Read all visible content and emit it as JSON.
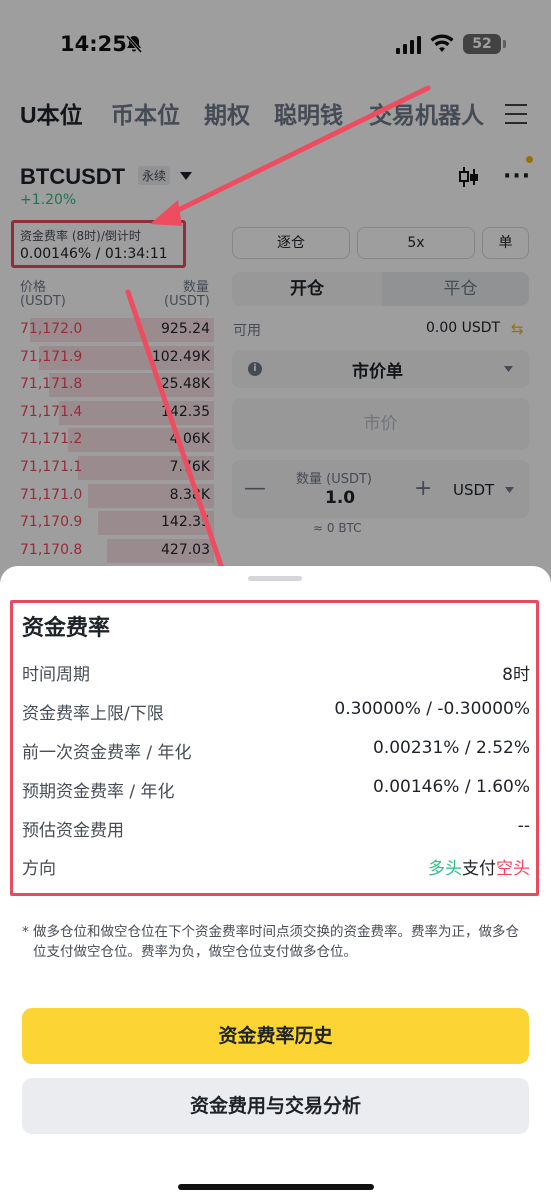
{
  "status_bar": {
    "time": "14:25",
    "battery": "52"
  },
  "top_nav": {
    "items": [
      "U本位",
      "币本位",
      "期权",
      "聪明钱",
      "交易机器人"
    ]
  },
  "ticker": {
    "symbol": "BTCUSDT",
    "tag": "永续",
    "change": "+1.20%"
  },
  "funding": {
    "label": "资金费率 (8时)/倒计时",
    "value": "0.00146% / 01:34:11"
  },
  "orderbook": {
    "price_header": "价格",
    "price_unit": "(USDT)",
    "qty_header": "数量",
    "qty_unit": "(USDT)",
    "rows": [
      {
        "price": "71,172.0",
        "qty": "925.24",
        "depth": 0.95
      },
      {
        "price": "71,171.9",
        "qty": "102.49K",
        "depth": 0.9
      },
      {
        "price": "71,171.8",
        "qty": "25.48K",
        "depth": 0.85
      },
      {
        "price": "71,171.4",
        "qty": "142.35",
        "depth": 0.8
      },
      {
        "price": "71,171.2",
        "qty": "4.06K",
        "depth": 0.75
      },
      {
        "price": "71,171.1",
        "qty": "7.76K",
        "depth": 0.7
      },
      {
        "price": "71,171.0",
        "qty": "8.38K",
        "depth": 0.65
      },
      {
        "price": "71,170.9",
        "qty": "142.35",
        "depth": 0.6
      },
      {
        "price": "71,170.8",
        "qty": "427.03",
        "depth": 0.55
      }
    ]
  },
  "order_panel": {
    "margin_mode": "逐仓",
    "leverage": "5x",
    "position_mode": "单",
    "open_tab": "开仓",
    "close_tab": "平仓",
    "available_label": "可用",
    "available_value": "0.00 USDT",
    "swap_icon": "⇆",
    "order_type": "市价单",
    "price_placeholder": "市价",
    "qty_label": "数量 (USDT)",
    "qty_value": "1.0",
    "qty_unit": "USDT",
    "qty_btc": "≈ 0 BTC"
  },
  "sheet": {
    "title": "资金费率",
    "rows": [
      {
        "key": "时间周期",
        "value": "8时"
      },
      {
        "key": "资金费率上限/下限",
        "value": "0.30000% / -0.30000%"
      },
      {
        "key": "前一次资金费率 / 年化",
        "value": "0.00231% / 2.52%"
      },
      {
        "key": "预期资金费率 / 年化",
        "value": "0.00146% / 1.60%"
      },
      {
        "key": "预估资金费用",
        "value": "--"
      }
    ],
    "direction": {
      "key": "方向",
      "long": "多头",
      "pay": "支付",
      "short": "空头"
    },
    "footnote_star": "*",
    "footnote": "做多仓位和做空仓位在下个资金费率时间点须交换的资金费率。费率为正，做多仓位支付做空仓位。费率为负，做空仓位支付做多仓位。",
    "primary_button": "资金费率历史",
    "secondary_button": "资金费用与交易分析"
  },
  "colors": {
    "accent": "#fcd535",
    "long": "#2ebd85",
    "short": "#f6465d",
    "annotation": "#e84a5f"
  }
}
